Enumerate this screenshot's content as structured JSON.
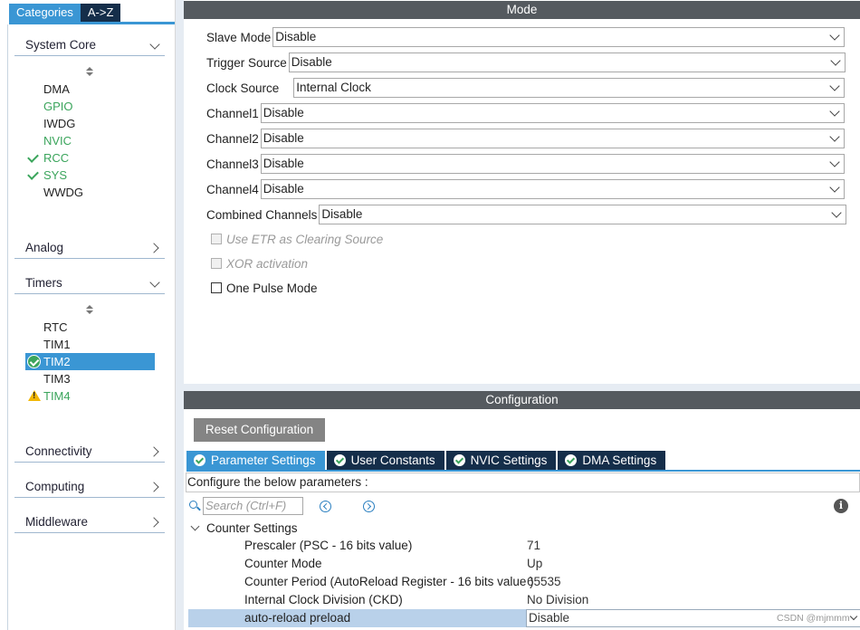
{
  "left": {
    "tabs": [
      "Categories",
      "A->Z"
    ],
    "categories": {
      "system_core": "System Core",
      "analog": "Analog",
      "timers": "Timers",
      "connectivity": "Connectivity",
      "computing": "Computing",
      "middleware": "Middleware"
    },
    "system_core_items": [
      {
        "label": "DMA",
        "state": "plain"
      },
      {
        "label": "GPIO",
        "state": "green"
      },
      {
        "label": "IWDG",
        "state": "plain"
      },
      {
        "label": "NVIC",
        "state": "green"
      },
      {
        "label": "RCC",
        "state": "checked"
      },
      {
        "label": "SYS",
        "state": "checked"
      },
      {
        "label": "WWDG",
        "state": "plain"
      }
    ],
    "timer_items": [
      {
        "label": "RTC",
        "state": "plain"
      },
      {
        "label": "TIM1",
        "state": "plain"
      },
      {
        "label": "TIM2",
        "state": "selected"
      },
      {
        "label": "TIM3",
        "state": "plain"
      },
      {
        "label": "TIM4",
        "state": "warning"
      }
    ]
  },
  "mode": {
    "title": "Mode",
    "fields": {
      "slave_mode": {
        "label": "Slave Mode",
        "value": "Disable"
      },
      "trigger_source": {
        "label": "Trigger Source",
        "value": "Disable"
      },
      "clock_source": {
        "label": "Clock Source",
        "value": "Internal Clock"
      },
      "channel1": {
        "label": "Channel1",
        "value": "Disable"
      },
      "channel2": {
        "label": "Channel2",
        "value": "Disable"
      },
      "channel3": {
        "label": "Channel3",
        "value": "Disable"
      },
      "channel4": {
        "label": "Channel4",
        "value": "Disable"
      },
      "combined_channels": {
        "label": "Combined Channels",
        "value": "Disable"
      }
    },
    "checkboxes": {
      "etr": {
        "label": "Use ETR as Clearing Source",
        "checked": false,
        "disabled": true
      },
      "xor": {
        "label": "XOR activation",
        "checked": false,
        "disabled": true
      },
      "one_pulse": {
        "label": "One Pulse Mode",
        "checked": false,
        "disabled": false
      }
    }
  },
  "config": {
    "title": "Configuration",
    "reset_label": "Reset Configuration",
    "tabs": [
      "Parameter Settings",
      "User Constants",
      "NVIC Settings",
      "DMA Settings"
    ],
    "configure_text": "Configure the below parameters :",
    "search_placeholder": "Search (Ctrl+F)",
    "group": "Counter Settings",
    "params": [
      {
        "name": "Prescaler (PSC - 16 bits value)",
        "value": "71"
      },
      {
        "name": "Counter Mode",
        "value": "Up"
      },
      {
        "name": "Counter Period (AutoReload Register - 16 bits value )",
        "value": "65535"
      },
      {
        "name": "Internal Clock Division (CKD)",
        "value": "No Division"
      },
      {
        "name": "auto-reload preload",
        "value": "Disable"
      }
    ],
    "watermark": "CSDN @mjmmm"
  },
  "colors": {
    "accent": "#3a96d4",
    "dark_tab": "#152e4a",
    "header": "#555a5f",
    "ok_green": "#3ba55c",
    "warning": "#f2b705"
  }
}
